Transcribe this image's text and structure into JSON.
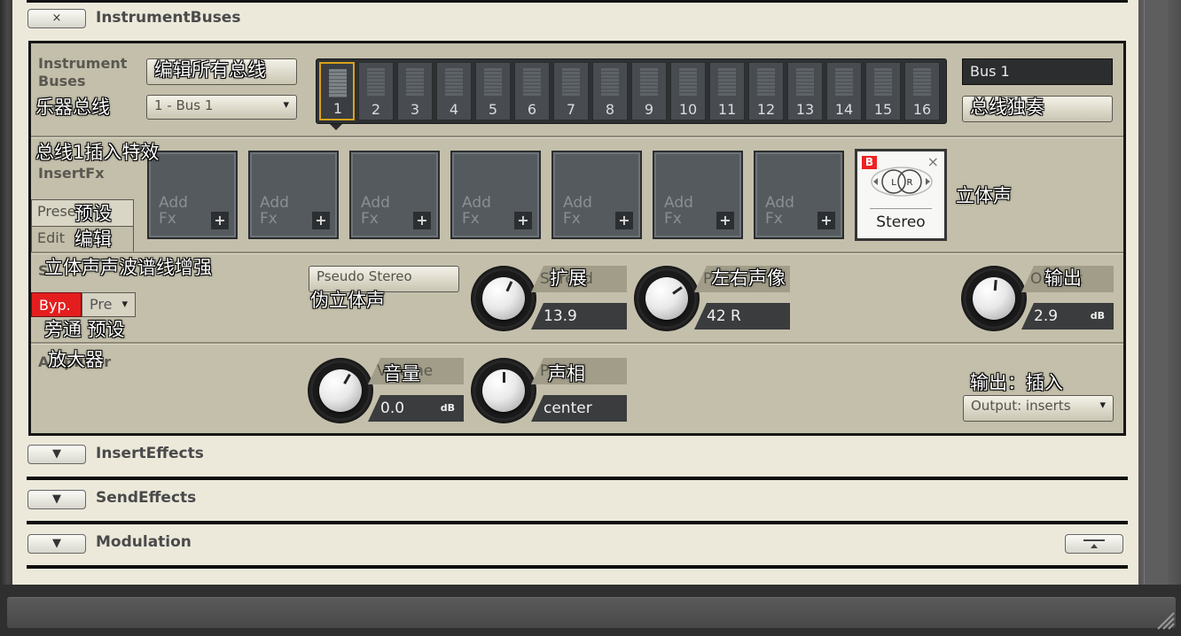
{
  "sections": {
    "instrument_buses": "InstrumentBuses",
    "insert_effects": "InsertEffects",
    "send_effects": "SendEffects",
    "modulation": "Modulation"
  },
  "header": {
    "close_glyph": "×",
    "expand_glyph": "▼"
  },
  "panel": {
    "title_line1": "Instrument",
    "title_line2": "Buses",
    "edit_all_button": "编辑所有总线",
    "bus_select": "1 - Bus 1",
    "bus_numbers": [
      "1",
      "2",
      "3",
      "4",
      "5",
      "6",
      "7",
      "8",
      "9",
      "10",
      "11",
      "12",
      "13",
      "14",
      "15",
      "16"
    ],
    "selected_bus": "1",
    "bus_name": "Bus 1",
    "solo_button": "总线独奏",
    "insertfx_label": "InsertFx",
    "tab_preset": "Preset",
    "tab_edit": "Edit",
    "fx_slot_text_line1": "Add",
    "fx_slot_text_line2": "Fx",
    "fx_slot_plus": "+",
    "stereo_slot": {
      "badge": "B",
      "close": "×",
      "name": "Stereo",
      "graphic_left": "L",
      "graphic_right": "R"
    },
    "stereo_module_label": "S",
    "bypass": "Byp.",
    "preset_drop": "Pre",
    "pseudo_stereo_button": "Pseudo Stereo",
    "spread": {
      "label": "Spread",
      "value": "13.9"
    },
    "pan_lr": {
      "label": "Pan",
      "value": "42 R"
    },
    "output": {
      "label": "Output",
      "value": "2.9",
      "unit": "dB"
    },
    "amplifier_label": "Amplifier",
    "volume": {
      "label": "Volume",
      "value": "0.0",
      "unit": "dB"
    },
    "pan": {
      "label": "Pan",
      "value": "center"
    },
    "output_select": "Output: inserts"
  },
  "annotations": {
    "instrument_buses": "乐器总线",
    "bus1_insert_fx": "总线1插入特效",
    "preset": "预设",
    "edit": "编辑",
    "stereo": "立体声",
    "stereo_enhance": "立体声声波谱线增强",
    "pseudo_stereo": "伪立体声",
    "spread": "扩展",
    "lr_pan": "左右声像",
    "output": "输出",
    "bypass_preset": "旁通 预设",
    "amplifier": "放大器",
    "volume": "音量",
    "pan": "声相",
    "output_inserts": "输出：插入"
  }
}
